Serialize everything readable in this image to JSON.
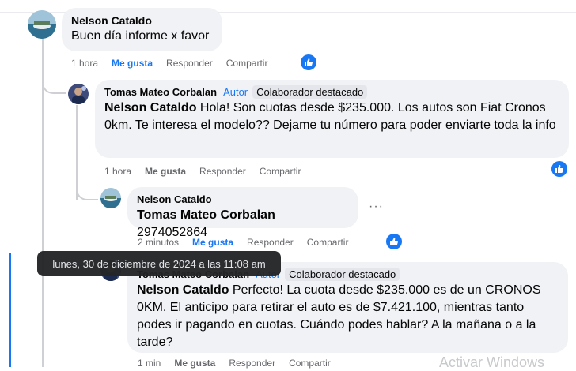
{
  "comments": [
    {
      "author": "Nelson Cataldo",
      "text": "Buen día informe x favor",
      "time": "1 hora",
      "like": "Me gusta",
      "reply": "Responder",
      "share": "Compartir"
    },
    {
      "author": "Tomas Mateo Corbalan",
      "author_badge": "Autor",
      "top_badge": "Colaborador destacado",
      "mention": "Nelson Cataldo",
      "text": " Hola! Son cuotas desde $235.000. Los autos son Fiat Cronos 0km. Te interesa el modelo?? Dejame tu número para poder enviarte toda la info",
      "time": "1 hora",
      "like": "Me gusta",
      "reply": "Responder",
      "share": "Compartir"
    },
    {
      "author": "Nelson Cataldo",
      "mention": "Tomas Mateo Corbalan",
      "text": " 2974052864",
      "time": "2 minutos",
      "like": "Me gusta",
      "reply": "Responder",
      "share": "Compartir"
    },
    {
      "author": "Tomas Mateo Corbalan",
      "author_badge": "Autor",
      "top_badge": "Colaborador destacado",
      "mention": "Nelson Cataldo",
      "text": " Perfecto! La cuota desde $235.000 es de un CRONOS 0KM. El anticipo para retirar el auto es de $7.421.100, mientras tanto podes ir pagando en cuotas. Cuándo podes hablar? A la mañana o a la tarde?",
      "time": "1 min",
      "like": "Me gusta",
      "reply": "Responder",
      "share": "Compartir"
    }
  ],
  "tooltip": "lunes, 30 de diciembre de 2024 a las 11:08 am",
  "more_options": "···",
  "watermark": "Activar Windows",
  "colors": {
    "accent": "#1877f2",
    "bubble": "#f0f2f5",
    "secondary_text": "#65676b"
  }
}
